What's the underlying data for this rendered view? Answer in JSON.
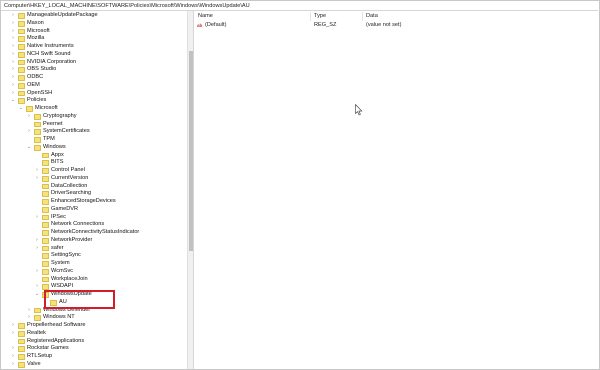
{
  "address": "Computer\\HKEY_LOCAL_MACHINE\\SOFTWARE\\Policies\\Microsoft\\Windows\\WindowsUpdate\\AU",
  "tree": [
    {
      "label": "ManageableUpdatePackage",
      "toggle": ">"
    },
    {
      "label": "Maxon",
      "toggle": ">"
    },
    {
      "label": "Microsoft",
      "toggle": ">"
    },
    {
      "label": "Mozilla",
      "toggle": ">"
    },
    {
      "label": "Native Instruments",
      "toggle": ">"
    },
    {
      "label": "NCH Swift Sound",
      "toggle": ">"
    },
    {
      "label": "NVIDIA Corporation",
      "toggle": ">"
    },
    {
      "label": "OBS Studio",
      "toggle": ">"
    },
    {
      "label": "ODBC",
      "toggle": ">"
    },
    {
      "label": "OEM",
      "toggle": ">"
    },
    {
      "label": "OpenSSH",
      "toggle": ">"
    },
    {
      "label": "Policies",
      "toggle": "v"
    },
    {
      "label": "Microsoft",
      "toggle": "v"
    },
    {
      "label": "Cryptography",
      "toggle": ">"
    },
    {
      "label": "Peernet",
      "toggle": ""
    },
    {
      "label": "SystemCertificates",
      "toggle": ">"
    },
    {
      "label": "TPM",
      "toggle": ""
    },
    {
      "label": "Windows",
      "toggle": "v"
    },
    {
      "label": "Appx",
      "toggle": ""
    },
    {
      "label": "BITS",
      "toggle": ""
    },
    {
      "label": "Control Panel",
      "toggle": ">"
    },
    {
      "label": "CurrentVersion",
      "toggle": ">"
    },
    {
      "label": "DataCollection",
      "toggle": ""
    },
    {
      "label": "DriverSearching",
      "toggle": ""
    },
    {
      "label": "EnhancedStorageDevices",
      "toggle": ""
    },
    {
      "label": "GameDVR",
      "toggle": ""
    },
    {
      "label": "IPSec",
      "toggle": ">"
    },
    {
      "label": "Network Connections",
      "toggle": ""
    },
    {
      "label": "NetworkConnectivityStatusIndicator",
      "toggle": ""
    },
    {
      "label": "NetworkProvider",
      "toggle": ">"
    },
    {
      "label": "safer",
      "toggle": ">"
    },
    {
      "label": "SettingSync",
      "toggle": ""
    },
    {
      "label": "System",
      "toggle": ""
    },
    {
      "label": "WcmSvc",
      "toggle": ">"
    },
    {
      "label": "WorkplaceJoin",
      "toggle": ""
    },
    {
      "label": "WSDAPI",
      "toggle": ">"
    },
    {
      "label": "WindowsUpdate",
      "toggle": "v"
    },
    {
      "label": "AU",
      "toggle": ""
    },
    {
      "label": "Windows Defender",
      "toggle": ">"
    },
    {
      "label": "Windows NT",
      "toggle": ">"
    },
    {
      "label": "Propellerhead Software",
      "toggle": ">"
    },
    {
      "label": "Realtek",
      "toggle": ">"
    },
    {
      "label": "RegisteredApplications",
      "toggle": ""
    },
    {
      "label": "Rockstar Games",
      "toggle": ">"
    },
    {
      "label": "RTLSetup",
      "toggle": ">"
    },
    {
      "label": "Valve",
      "toggle": ">"
    }
  ],
  "columns": {
    "name": "Name",
    "type": "Type",
    "data": "Data"
  },
  "values": [
    {
      "icon": "ab",
      "name": "(Default)",
      "type": "REG_SZ",
      "data": "(value not set)"
    }
  ]
}
